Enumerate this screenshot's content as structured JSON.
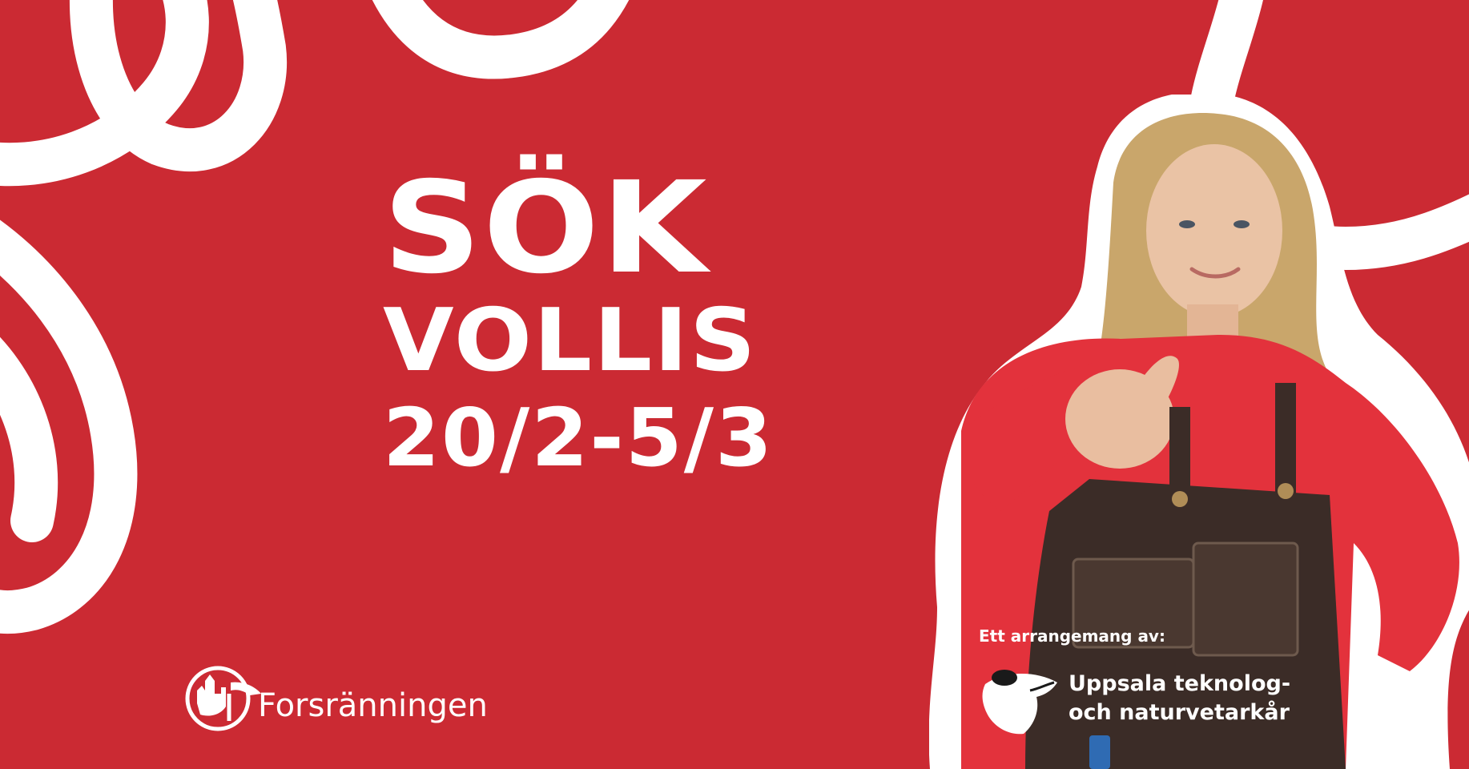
{
  "poster": {
    "headline_line1": "SÖK",
    "headline_line2": "VOLLIS",
    "headline_line3": "20/2-5/3",
    "background_color": "#cb2a33",
    "accent_color": "#ffffff"
  },
  "logos": {
    "forsranningen": {
      "name": "Forsränningen",
      "icon": "forsranningen-emblem-icon"
    },
    "organizer": {
      "caption": "Ett arrangemang av:",
      "name_line1": "Uppsala teknolog-",
      "name_line2": "och naturvetarkår",
      "icon": "utn-logo-icon"
    }
  },
  "photo": {
    "subject": "person-pointing-icon"
  }
}
